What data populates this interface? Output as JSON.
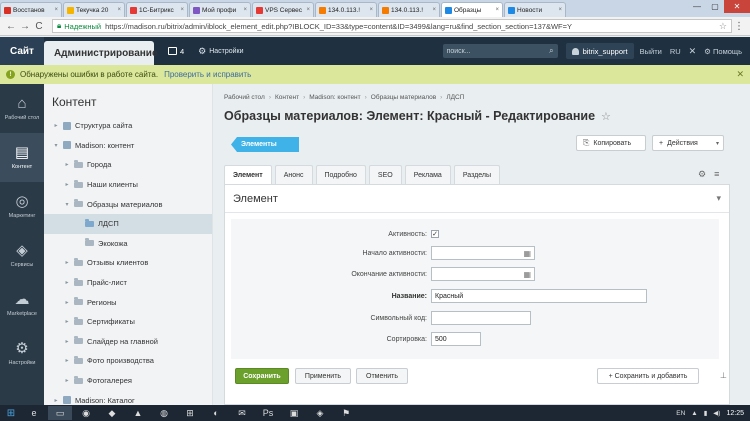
{
  "browser": {
    "tabs": [
      {
        "label": "Восстанов",
        "color": "#d93025",
        "active": false
      },
      {
        "label": "Текучка 20",
        "color": "#f4b400",
        "active": false
      },
      {
        "label": "1С-Битрикс",
        "color": "#e53935",
        "active": false
      },
      {
        "label": "Мой профи",
        "color": "#7e57c2",
        "active": false
      },
      {
        "label": "VPS Сервес",
        "color": "#e53935",
        "active": false
      },
      {
        "label": "134.0.113.!",
        "color": "#f57c00",
        "active": false
      },
      {
        "label": "134.0.113.!",
        "color": "#f57c00",
        "active": false
      },
      {
        "label": "Образцы",
        "color": "#1e88e5",
        "active": true
      },
      {
        "label": "Новости",
        "color": "#1e88e5",
        "active": false
      }
    ],
    "tab_close": "×",
    "win_minimize": "—",
    "win_maximize": "▢",
    "win_close": "✕",
    "back": "←",
    "forward": "→",
    "reload": "C",
    "secure_label": "Надежный",
    "url": "https://madison.ru/bitrix/admin/iblock_element_edit.php?IBLOCK_ID=33&type=content&ID=3499&lang=ru&find_section_section=137&WF=Y"
  },
  "header": {
    "site_label": "Сайт",
    "admin_label": "Администрирование",
    "notif_count": "4",
    "settings_label": "Настройки",
    "search_placeholder": "поиск...",
    "user_name": "bitrix_support",
    "logout_label": "Выйти",
    "lang_label": "RU",
    "help_label": "Помощь"
  },
  "error_bar": {
    "text": "Обнаружены ошибки в работе сайта.",
    "link": "Проверить и исправить",
    "close": "✕"
  },
  "left_menu": [
    {
      "label": "Рабочий стол",
      "icon": "⌂",
      "active": false
    },
    {
      "label": "Контент",
      "icon": "▤",
      "active": true
    },
    {
      "label": "Маркетинг",
      "icon": "◎",
      "active": false
    },
    {
      "label": "Сервисы",
      "icon": "◈",
      "active": false
    },
    {
      "label": "Marketplace",
      "icon": "☁",
      "active": false
    },
    {
      "label": "Настройки",
      "icon": "⚙",
      "active": false
    }
  ],
  "tree": {
    "title": "Контент",
    "items": [
      {
        "label": "Структура сайта",
        "level": 0,
        "arrow": "▸",
        "icon": "cube",
        "sel": false
      },
      {
        "label": "Madison: контент",
        "level": 0,
        "arrow": "▾",
        "icon": "cube",
        "sel": false
      },
      {
        "label": "Города",
        "level": 1,
        "arrow": "▸",
        "icon": "folder",
        "sel": false
      },
      {
        "label": "Наши клиенты",
        "level": 1,
        "arrow": "▸",
        "icon": "folder",
        "sel": false
      },
      {
        "label": "Образцы материалов",
        "level": 1,
        "arrow": "▾",
        "icon": "folder",
        "sel": false
      },
      {
        "label": "ЛДСП",
        "level": 2,
        "arrow": "",
        "icon": "folder-blue",
        "sel": true
      },
      {
        "label": "Экокожа",
        "level": 2,
        "arrow": "",
        "icon": "folder",
        "sel": false
      },
      {
        "label": "Отзывы клиентов",
        "level": 1,
        "arrow": "▸",
        "icon": "folder",
        "sel": false
      },
      {
        "label": "Прайс-лист",
        "level": 1,
        "arrow": "▸",
        "icon": "folder",
        "sel": false
      },
      {
        "label": "Регионы",
        "level": 1,
        "arrow": "▸",
        "icon": "folder",
        "sel": false
      },
      {
        "label": "Сертификаты",
        "level": 1,
        "arrow": "▸",
        "icon": "folder",
        "sel": false
      },
      {
        "label": "Слайдер на главной",
        "level": 1,
        "arrow": "▸",
        "icon": "folder",
        "sel": false
      },
      {
        "label": "Фото производства",
        "level": 1,
        "arrow": "▸",
        "icon": "folder",
        "sel": false
      },
      {
        "label": "Фотогалерея",
        "level": 1,
        "arrow": "▸",
        "icon": "folder",
        "sel": false
      },
      {
        "label": "Madison: Каталог",
        "level": 0,
        "arrow": "▸",
        "icon": "cube",
        "sel": false
      }
    ]
  },
  "main": {
    "breadcrumbs": [
      "Рабочий стол",
      "Контент",
      "Madison: контент",
      "Образцы материалов",
      "ЛДСП"
    ],
    "crumb_sep": "›",
    "title": "Образцы материалов: Элемент: Красный - Редактирование",
    "fav_star": "☆",
    "elements_button": "Элементы",
    "copy_button": "Копировать",
    "actions_button": "Действия",
    "tabs": [
      "Элемент",
      "Анонс",
      "Подробно",
      "SEO",
      "Реклама",
      "Разделы"
    ],
    "panel_title": "Элемент",
    "collapse": "▾",
    "fields": {
      "active_label": "Активность:",
      "active_checked": "✓",
      "start_label": "Начало активности:",
      "end_label": "Окончание активности:",
      "name_label": "Название:",
      "name_value": "Красный",
      "code_label": "Символьный код:",
      "code_value": "",
      "sort_label": "Сортировка:",
      "sort_value": "500"
    },
    "calendar_icon": "▦",
    "buttons": {
      "save": "Сохранить",
      "apply": "Применить",
      "cancel": "Отменить",
      "save_add": "+ Сохранить и добавить"
    },
    "copy_icon": "⎘",
    "actions_plus": "+",
    "actions_caret": "▾",
    "gear_icon": "⚙",
    "menu_icon": "≡",
    "pin_icon": "⊥"
  },
  "taskbar": {
    "start": "⊞",
    "apps": [
      "e",
      "▭",
      "◉",
      "◆",
      "▲",
      "◍",
      "⊞",
      "◐",
      "✉",
      "Ps",
      "▣",
      "◈",
      "⚑"
    ],
    "lang": "EN",
    "tray": [
      "▲",
      "▮",
      "◀)"
    ],
    "time": "12:25"
  },
  "colors": {
    "accent": "#3fb3e8",
    "save": "#6ba02c",
    "header": "#1f3141",
    "error_bar": "#dbe89b"
  }
}
